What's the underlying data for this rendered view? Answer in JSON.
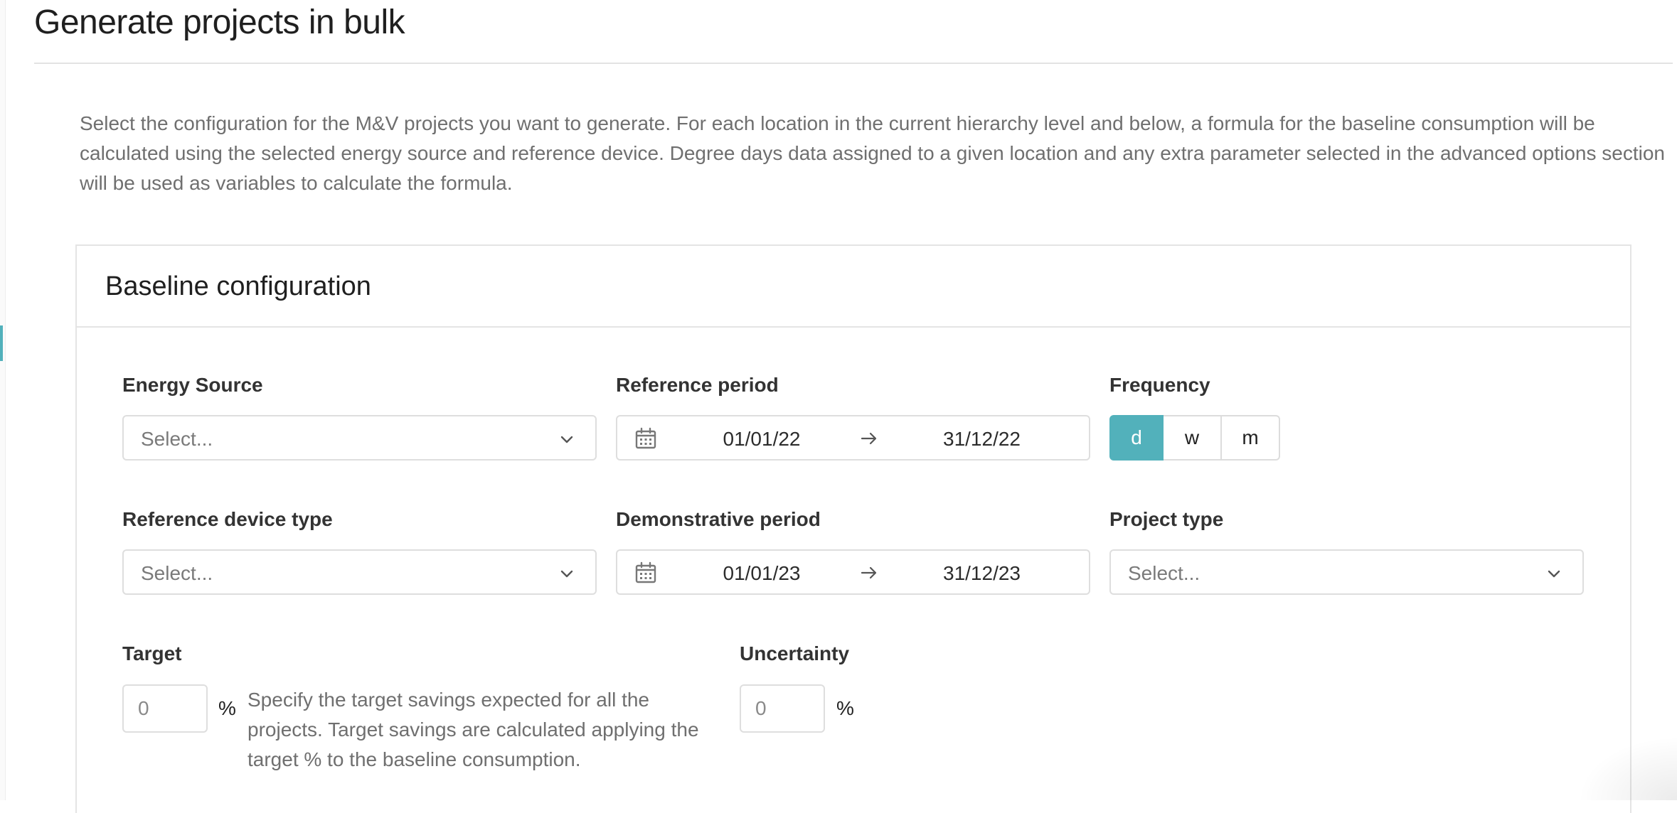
{
  "page": {
    "title": "Generate projects in bulk",
    "description": "Select the configuration for the M&V projects you want to generate. For each location in the current hierarchy level and below, a formula for the baseline consumption will be calculated using the selected energy source and reference device. Degree days data assigned to a given location and any extra parameter selected in the advanced options section will be used as variables to calculate the formula."
  },
  "card": {
    "title": "Baseline configuration"
  },
  "fields": {
    "energy_source": {
      "label": "Energy Source",
      "placeholder": "Select..."
    },
    "reference_period": {
      "label": "Reference period",
      "start": "01/01/22",
      "end": "31/12/22"
    },
    "frequency": {
      "label": "Frequency",
      "options": [
        "d",
        "w",
        "m"
      ],
      "selected": "d"
    },
    "reference_device_type": {
      "label": "Reference device type",
      "placeholder": "Select..."
    },
    "demonstrative_period": {
      "label": "Demonstrative period",
      "start": "01/01/23",
      "end": "31/12/23"
    },
    "project_type": {
      "label": "Project type",
      "placeholder": "Select..."
    },
    "target": {
      "label": "Target",
      "value": "0",
      "unit": "%",
      "help": "Specify the target savings expected for all the projects. Target savings are calculated applying the target % to the baseline consumption."
    },
    "uncertainty": {
      "label": "Uncertainty",
      "value": "0",
      "unit": "%"
    }
  },
  "icons": {
    "select_chevron": "chevron-down-icon",
    "calendar": "calendar-icon",
    "range_arrow": "arrow-right-icon"
  },
  "colors": {
    "accent": "#52b1bb",
    "border": "#dedede",
    "muted_text": "#6f6f6f"
  }
}
